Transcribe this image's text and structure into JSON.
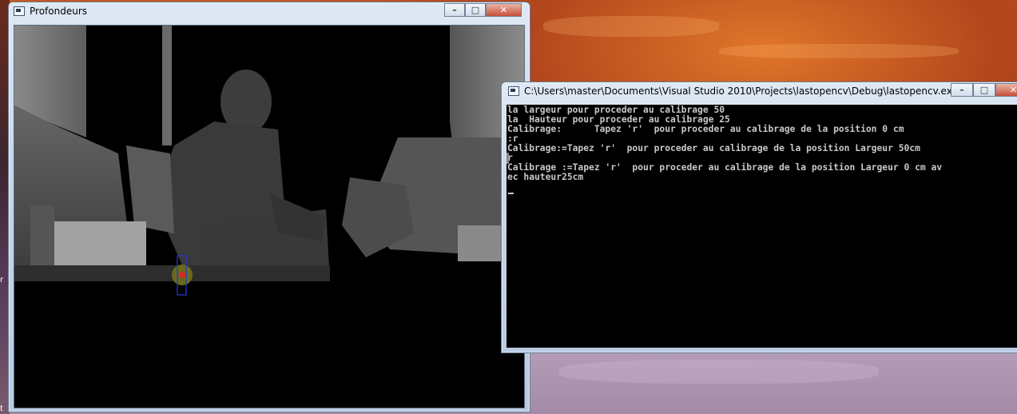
{
  "depth_window": {
    "title": "Profondeurs",
    "buttons": {
      "minimize": "–",
      "maximize": "□",
      "close": "✕"
    }
  },
  "console_window": {
    "title": "C:\\Users\\master\\Documents\\Visual Studio 2010\\Projects\\lastopencv\\Debug\\lastopencv.exe",
    "buttons": {
      "minimize": "–",
      "maximize": "□",
      "close": "✕"
    },
    "lines": [
      "la largeur pour proceder au calibrage 50",
      "la  Hauteur pour proceder au calibrage 25",
      "Calibrage:      Tapez 'r'  pour proceder au calibrage de la position 0 cm",
      ":r",
      "Calibrage:=Tapez 'r'  pour proceder au calibrage de la position Largeur 50cm",
      "r",
      "Calibrage :=Tapez 'r'  pour proceder au calibrage de la position Largeur 0 cm av",
      "ec hauteur25cm"
    ]
  },
  "desktop": {
    "left_edge_chars": [
      "r",
      "t"
    ]
  }
}
